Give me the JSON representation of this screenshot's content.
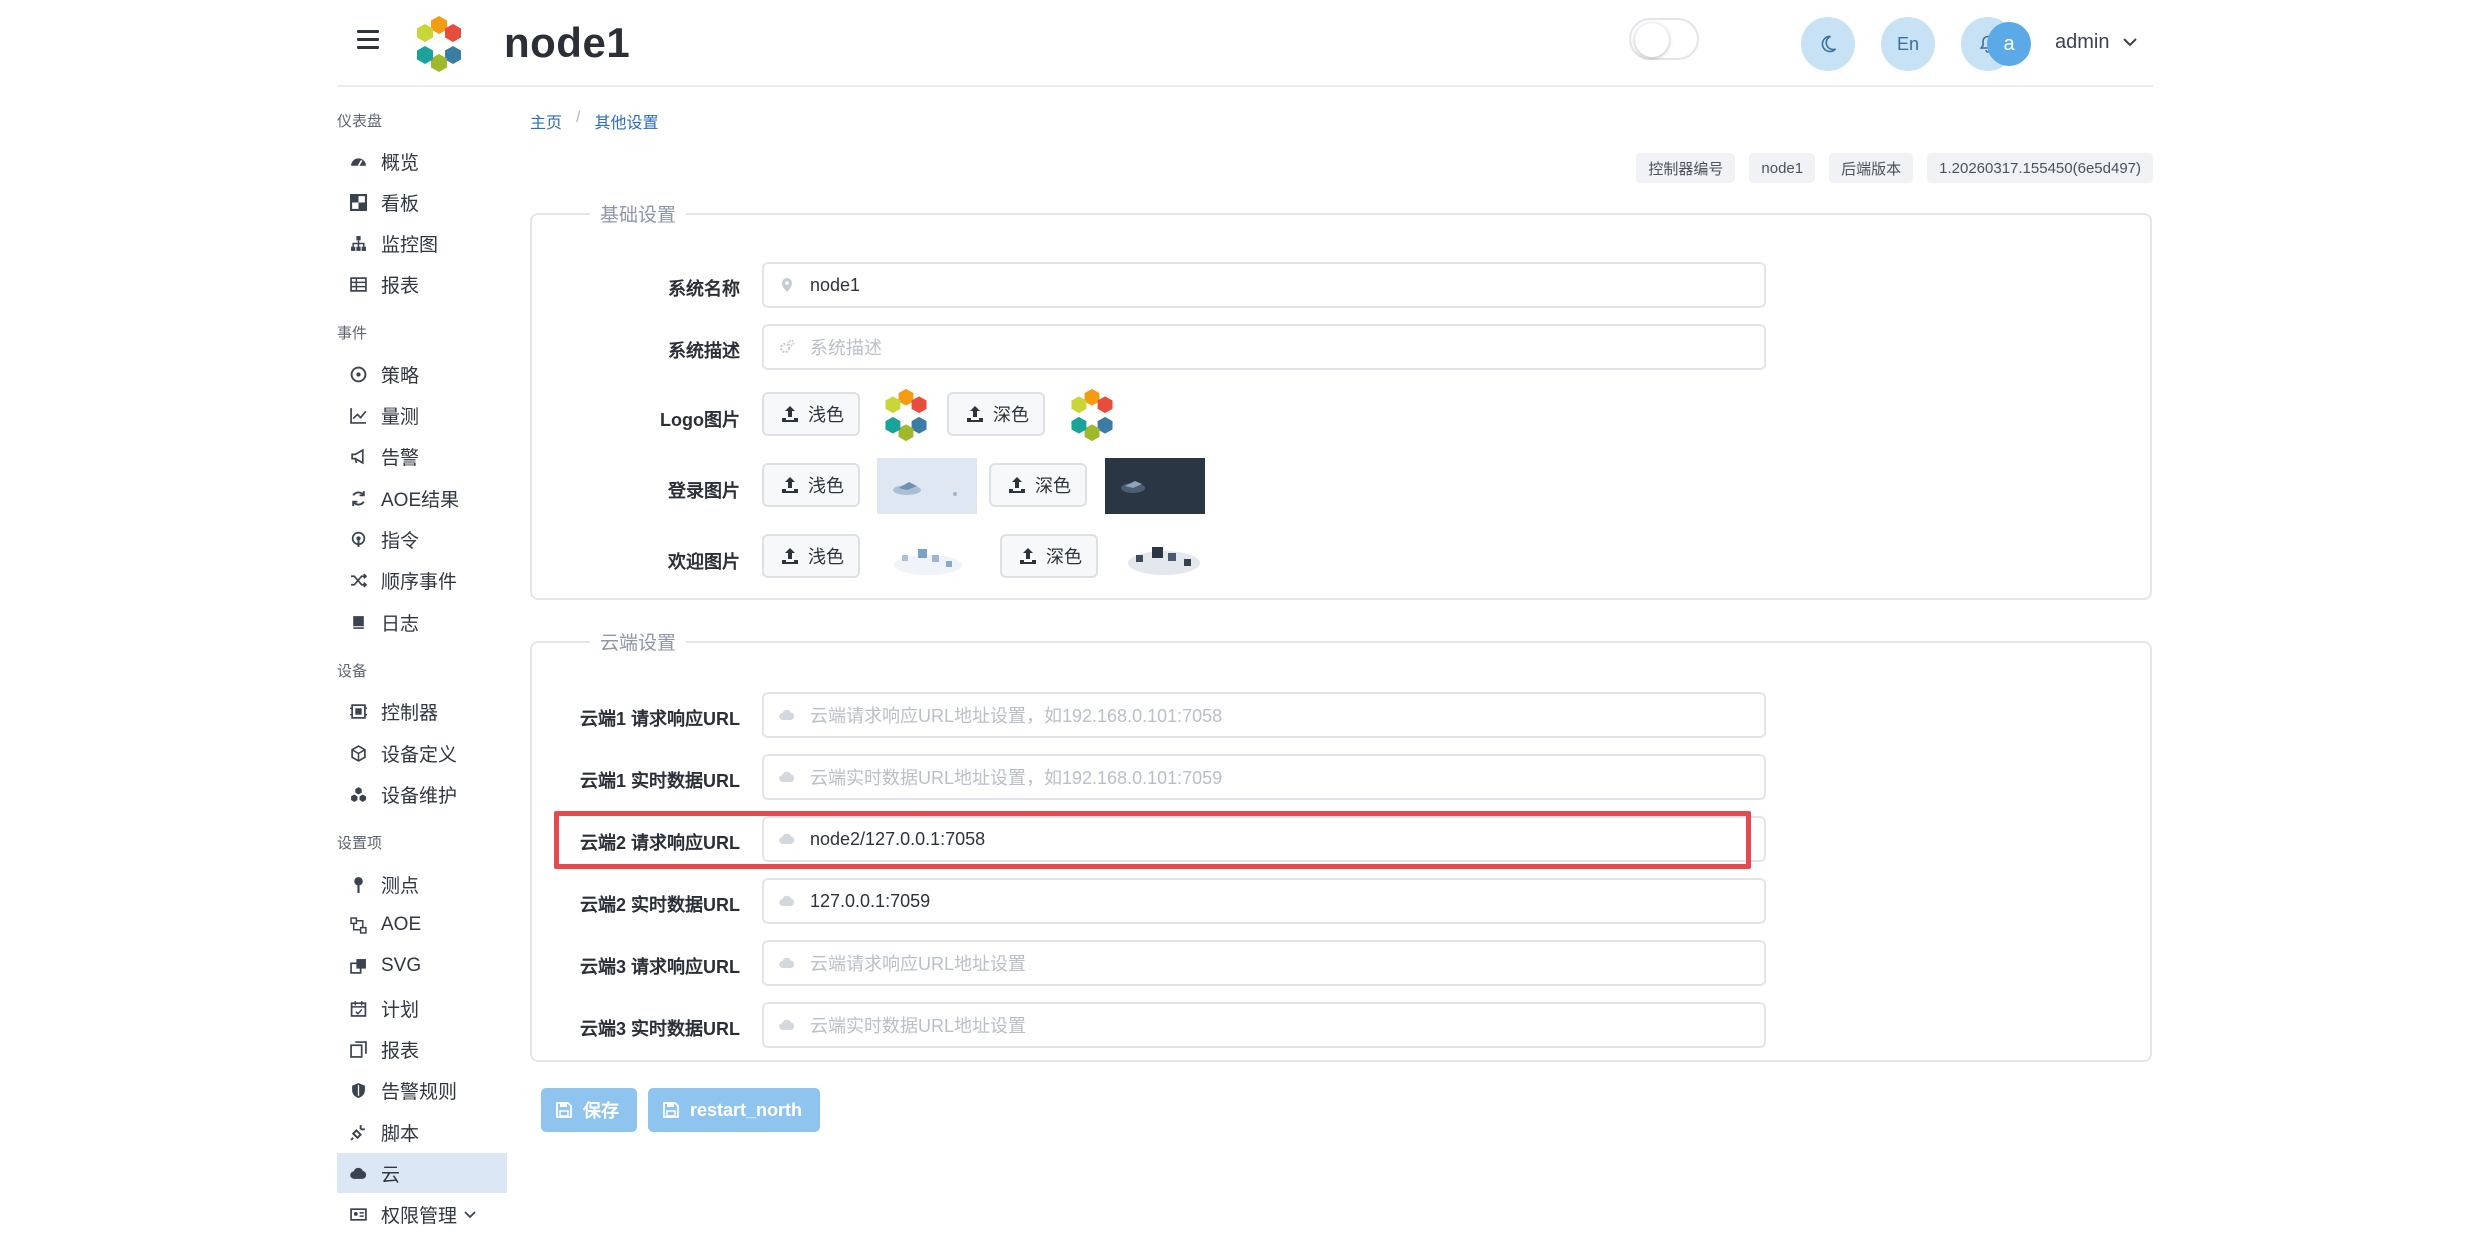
{
  "header": {
    "app_title": "node1",
    "lang_button": "En",
    "user_avatar": "a",
    "user_name": "admin",
    "icons": {
      "theme": "moon-icon",
      "notify": "bell-icon",
      "menu": "hamburger-icon"
    }
  },
  "sidebar": {
    "sections": [
      {
        "label": "仪表盘",
        "items": [
          {
            "label": "概览",
            "icon": "dashboard-icon"
          },
          {
            "label": "看板",
            "icon": "board-icon"
          },
          {
            "label": "监控图",
            "icon": "sitemap-icon"
          },
          {
            "label": "报表",
            "icon": "table-icon"
          }
        ]
      },
      {
        "label": "事件",
        "items": [
          {
            "label": "策略",
            "icon": "compass-icon"
          },
          {
            "label": "量测",
            "icon": "chart-line-icon"
          },
          {
            "label": "告警",
            "icon": "megaphone-icon"
          },
          {
            "label": "AOE结果",
            "icon": "refresh-icon"
          },
          {
            "label": "指令",
            "icon": "broadcast-icon"
          },
          {
            "label": "顺序事件",
            "icon": "shuffle-icon"
          },
          {
            "label": "日志",
            "icon": "book-icon"
          }
        ]
      },
      {
        "label": "设备",
        "items": [
          {
            "label": "控制器",
            "icon": "controller-icon"
          },
          {
            "label": "设备定义",
            "icon": "cube-icon"
          },
          {
            "label": "设备维护",
            "icon": "cubes-icon"
          }
        ]
      },
      {
        "label": "设置项",
        "items": [
          {
            "label": "测点",
            "icon": "pin-icon"
          },
          {
            "label": "AOE",
            "icon": "network-icon"
          },
          {
            "label": "SVG",
            "icon": "svg-icon"
          },
          {
            "label": "计划",
            "icon": "calendar-icon"
          },
          {
            "label": "报表",
            "icon": "copy-icon"
          },
          {
            "label": "告警规则",
            "icon": "shield-icon"
          },
          {
            "label": "脚本",
            "icon": "plug-icon"
          },
          {
            "label": "云",
            "icon": "cloud-icon",
            "active": true
          },
          {
            "label": "权限管理",
            "icon": "id-card-icon",
            "has_children": true
          }
        ]
      }
    ]
  },
  "breadcrumb": [
    "主页",
    "其他设置"
  ],
  "version_tags": [
    "控制器编号",
    "node1",
    "后端版本",
    "1.20260317.155450(6e5d497)"
  ],
  "basic_settings": {
    "legend": "基础设置",
    "system_name": {
      "label": "系统名称",
      "value": "node1",
      "icon": "map-marker-icon"
    },
    "system_desc": {
      "label": "系统描述",
      "placeholder": "系统描述",
      "icon": "gears-icon"
    },
    "logo_image": {
      "label": "Logo图片",
      "light": "浅色",
      "dark": "深色"
    },
    "login_image": {
      "label": "登录图片",
      "light": "浅色",
      "dark": "深色"
    },
    "welcome_image": {
      "label": "欢迎图片",
      "light": "浅色",
      "dark": "深色"
    }
  },
  "cloud_settings": {
    "legend": "云端设置",
    "rows": [
      {
        "label": "云端1 请求响应URL",
        "value": "",
        "placeholder": "云端请求响应URL地址设置，如192.168.0.101:7058"
      },
      {
        "label": "云端1 实时数据URL",
        "value": "",
        "placeholder": "云端实时数据URL地址设置，如192.168.0.101:7059"
      },
      {
        "label": "云端2 请求响应URL",
        "value": "node2/127.0.0.1:7058",
        "placeholder": "",
        "highlighted": true
      },
      {
        "label": "云端2 实时数据URL",
        "value": "127.0.0.1:7059",
        "placeholder": ""
      },
      {
        "label": "云端3 请求响应URL",
        "value": "",
        "placeholder": "云端请求响应URL地址设置"
      },
      {
        "label": "云端3 实时数据URL",
        "value": "",
        "placeholder": "云端实时数据URL地址设置"
      }
    ]
  },
  "actions": {
    "save": "保存",
    "restart": "restart_north"
  },
  "colors": {
    "primary_light": "#8fc4ee",
    "highlight": "#e5484d",
    "active_bg": "#dce7f5",
    "link": "#2b6cc4"
  }
}
